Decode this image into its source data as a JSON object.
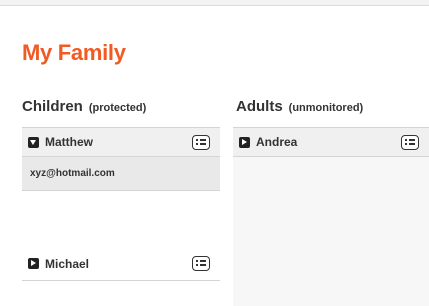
{
  "page": {
    "title": "My Family"
  },
  "children": {
    "heading": "Children",
    "subheading": "(protected)",
    "items": [
      {
        "name": "Matthew",
        "expanded": true,
        "email": "xyz@hotmail.com"
      },
      {
        "name": "Michael",
        "expanded": false
      }
    ]
  },
  "adults": {
    "heading": "Adults",
    "subheading": "(unmonitored)",
    "items": [
      {
        "name": "Andrea",
        "expanded": false
      }
    ]
  },
  "icons": {
    "expanded": "caret-down-icon",
    "collapsed": "caret-right-icon",
    "details": "list-details-icon"
  },
  "colors": {
    "accent": "#f15a22",
    "text": "#333333"
  }
}
